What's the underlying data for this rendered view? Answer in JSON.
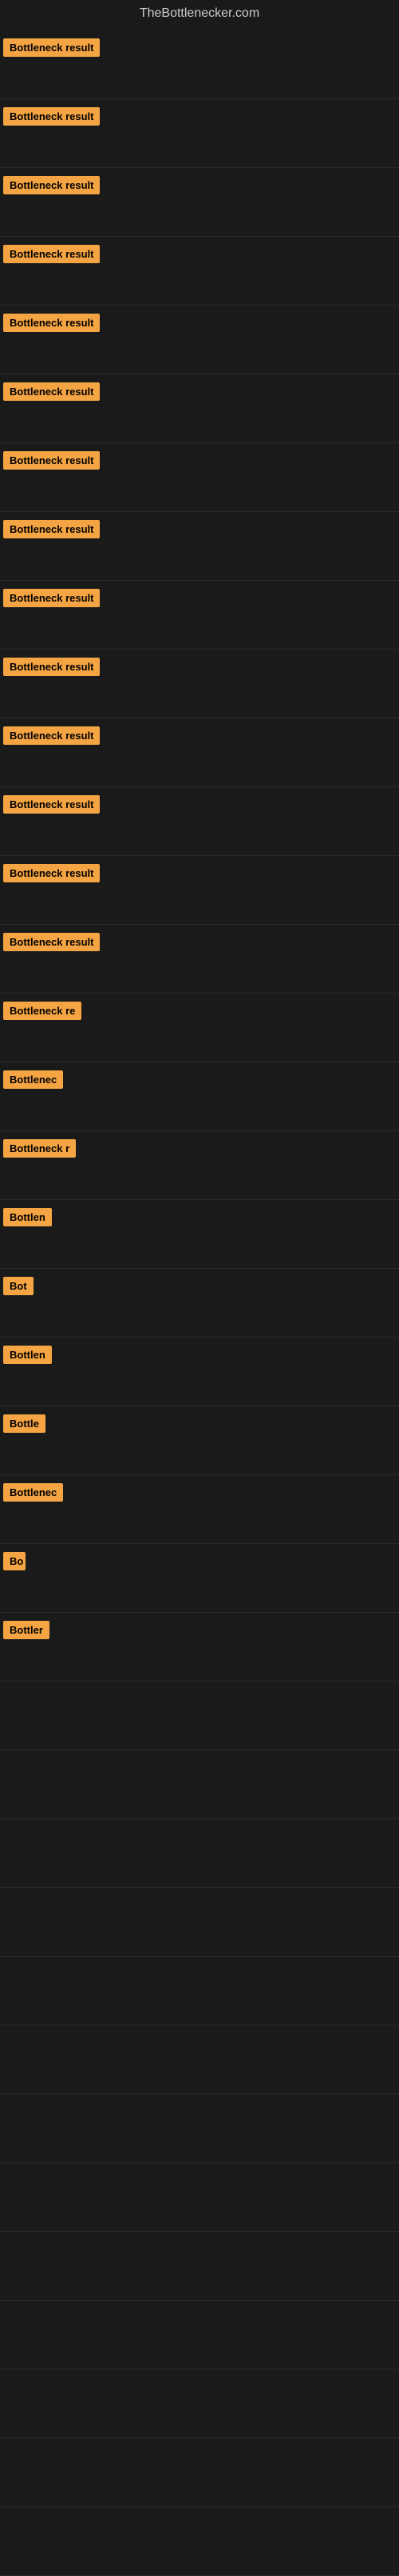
{
  "site": {
    "title": "TheBottlenecker.com"
  },
  "badges": [
    {
      "id": 1,
      "label": "Bottleneck result",
      "width": 130
    },
    {
      "id": 2,
      "label": "Bottleneck result",
      "width": 130
    },
    {
      "id": 3,
      "label": "Bottleneck result",
      "width": 130
    },
    {
      "id": 4,
      "label": "Bottleneck result",
      "width": 130
    },
    {
      "id": 5,
      "label": "Bottleneck result",
      "width": 130
    },
    {
      "id": 6,
      "label": "Bottleneck result",
      "width": 130
    },
    {
      "id": 7,
      "label": "Bottleneck result",
      "width": 130
    },
    {
      "id": 8,
      "label": "Bottleneck result",
      "width": 130
    },
    {
      "id": 9,
      "label": "Bottleneck result",
      "width": 130
    },
    {
      "id": 10,
      "label": "Bottleneck result",
      "width": 130
    },
    {
      "id": 11,
      "label": "Bottleneck result",
      "width": 130
    },
    {
      "id": 12,
      "label": "Bottleneck result",
      "width": 130
    },
    {
      "id": 13,
      "label": "Bottleneck result",
      "width": 130
    },
    {
      "id": 14,
      "label": "Bottleneck result",
      "width": 130
    },
    {
      "id": 15,
      "label": "Bottleneck re",
      "width": 105
    },
    {
      "id": 16,
      "label": "Bottlenec",
      "width": 80
    },
    {
      "id": 17,
      "label": "Bottleneck r",
      "width": 95
    },
    {
      "id": 18,
      "label": "Bottlen",
      "width": 68
    },
    {
      "id": 19,
      "label": "Bot",
      "width": 38
    },
    {
      "id": 20,
      "label": "Bottlen",
      "width": 68
    },
    {
      "id": 21,
      "label": "Bottle",
      "width": 58
    },
    {
      "id": 22,
      "label": "Bottlenec",
      "width": 80
    },
    {
      "id": 23,
      "label": "Bo",
      "width": 28
    },
    {
      "id": 24,
      "label": "Bottler",
      "width": 60
    }
  ],
  "colors": {
    "badge_bg": "#f5a443",
    "badge_text": "#000000",
    "background": "#1a1a1a",
    "title_text": "#cccccc"
  }
}
